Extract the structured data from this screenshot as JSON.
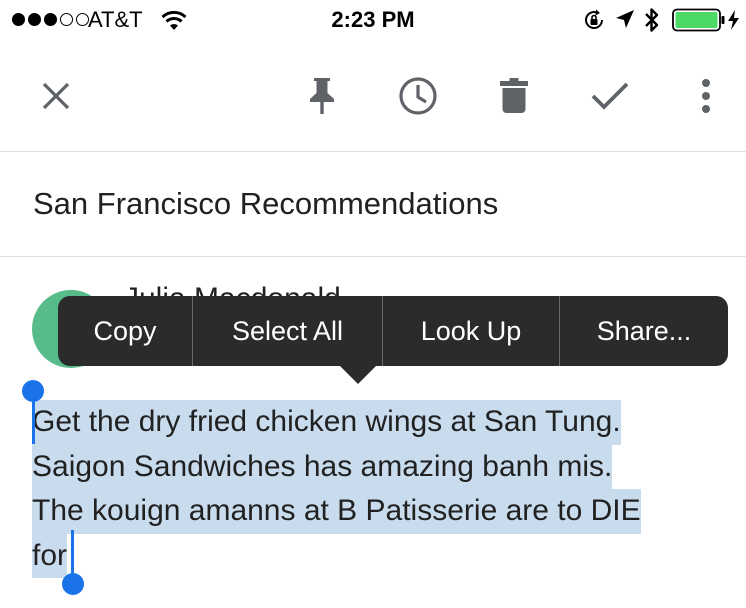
{
  "status_bar": {
    "carrier": "AT&T",
    "time": "2:23 PM",
    "signal_bars_filled": 3,
    "signal_bars_total": 5,
    "battery_color": "#4cd964"
  },
  "toolbar": {
    "icons": [
      "close-icon",
      "pin-icon",
      "reminder-clock-icon",
      "trash-icon",
      "check-icon",
      "more-vert-icon"
    ]
  },
  "note": {
    "title": "San Francisco Recommendations",
    "owner_name": "Julia Macdonald",
    "avatar_color": "#57bb8a",
    "body_lines": [
      "Get the dry fried chicken wings at San Tung.",
      "Saigon Sandwiches has amazing banh mis.",
      "The kouign amanns at B Patisserie are to DIE",
      "for"
    ],
    "selection_color": "#c9dcee"
  },
  "edit_menu": {
    "items": [
      "Copy",
      "Select All",
      "Look Up",
      "Share..."
    ]
  },
  "colors": {
    "icon_gray": "#5f6368",
    "handle_blue": "#1a73e8",
    "menu_bg": "#2b2b2b"
  }
}
